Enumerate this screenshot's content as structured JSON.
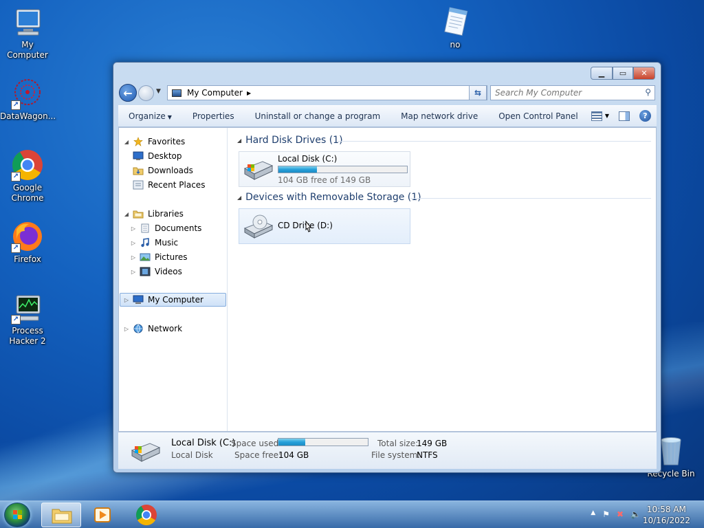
{
  "desktop": {
    "icons": [
      {
        "label": "My Computer"
      },
      {
        "label": "DataWagon..."
      },
      {
        "label": "Google Chrome"
      },
      {
        "label": "Firefox"
      },
      {
        "label": "Process Hacker 2"
      },
      {
        "label": "no"
      },
      {
        "label": "Recycle Bin"
      }
    ]
  },
  "window": {
    "address": {
      "crumb": "My Computer",
      "search_placeholder": "Search My Computer"
    },
    "toolbar": {
      "organize": "Organize",
      "properties": "Properties",
      "uninstall": "Uninstall or change a program",
      "map_drive": "Map network drive",
      "control_panel": "Open Control Panel"
    },
    "nav": {
      "favorites": "Favorites",
      "desktop": "Desktop",
      "downloads": "Downloads",
      "recent": "Recent Places",
      "libraries": "Libraries",
      "documents": "Documents",
      "music": "Music",
      "pictures": "Pictures",
      "videos": "Videos",
      "computer": "My Computer",
      "network": "Network"
    },
    "groups": {
      "hdd": "Hard Disk Drives (1)",
      "removable": "Devices with Removable Storage (1)"
    },
    "drives": {
      "c_name": "Local Disk (C:)",
      "c_free": "104 GB free of 149 GB",
      "c_used_fraction": 0.3,
      "d_name": "CD Drive (D:)"
    },
    "details": {
      "name": "Local Disk (C:)",
      "type": "Local Disk",
      "space_used_label": "Space used:",
      "space_free_label": "Space free:",
      "space_free": "104 GB",
      "total_label": "Total size:",
      "total": "149 GB",
      "fs_label": "File system:",
      "fs": "NTFS"
    }
  },
  "taskbar": {
    "time": "10:58 AM",
    "date": "10/16/2022"
  },
  "colors": {
    "accent": "#26a0da",
    "link": "#1e3e6e"
  }
}
